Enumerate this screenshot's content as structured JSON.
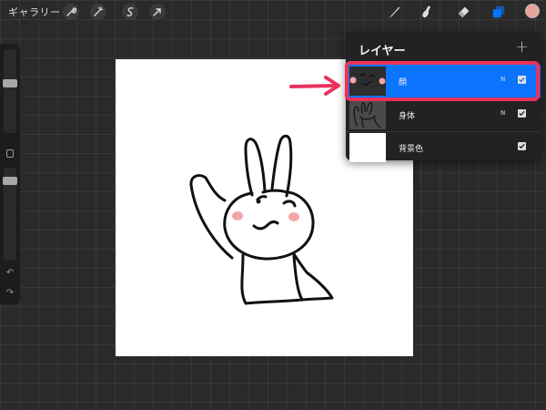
{
  "topbar": {
    "gallery_label": "ギャラリー",
    "left_tools": [
      "wrench-icon",
      "magic-wand-icon",
      "selection-icon",
      "transform-arrow-icon"
    ],
    "right_tools": [
      "brush-icon",
      "smudge-icon",
      "eraser-icon",
      "layers-icon"
    ],
    "color": "#e8a39a"
  },
  "sidebar": {
    "brush_size_level": 0.75,
    "opacity_level": 0.1
  },
  "layers_panel": {
    "title": "レイヤー",
    "add_label": "+",
    "layers": [
      {
        "name": "顔",
        "mode": "N",
        "visible": true,
        "selected": true
      },
      {
        "name": "身体",
        "mode": "N",
        "visible": true,
        "selected": false
      },
      {
        "name": "背景色",
        "mode": "",
        "visible": true,
        "selected": false
      }
    ]
  },
  "annotation": {
    "highlight_color": "#e8325c",
    "arrow_color": "#e8325c"
  }
}
